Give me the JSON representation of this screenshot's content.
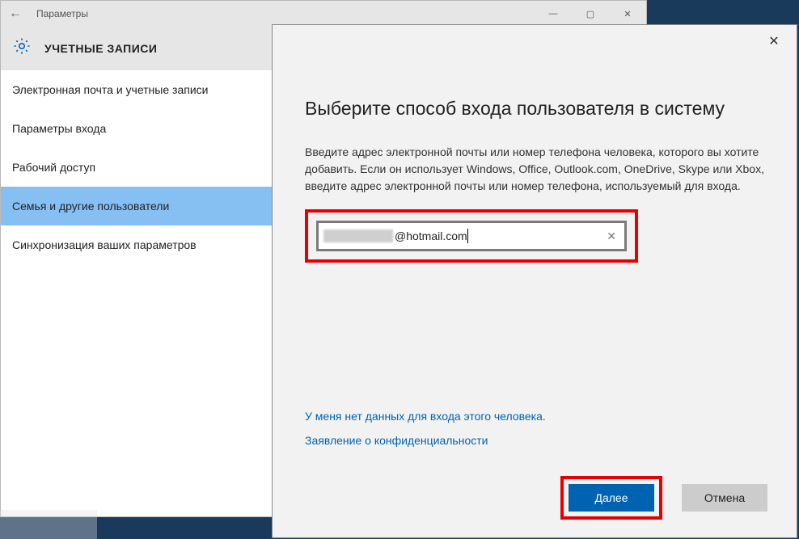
{
  "settings": {
    "titlebar_label": "Параметры",
    "heading": "УЧЕТНЫЕ ЗАПИСИ",
    "sidebar": [
      {
        "label": "Электронная почта и учетные записи",
        "selected": false
      },
      {
        "label": "Параметры входа",
        "selected": false
      },
      {
        "label": "Рабочий доступ",
        "selected": false
      },
      {
        "label": "Семья и другие пользователи",
        "selected": true
      },
      {
        "label": "Синхронизация ваших параметров",
        "selected": false
      }
    ]
  },
  "dialog": {
    "title": "Выберите способ входа пользователя в систему",
    "description": "Введите адрес электронной почты или номер телефона человека, которого вы хотите добавить. Если он использует Windows, Office, Outlook.com, OneDrive, Skype или Xbox, введите адрес электронной почты или номер телефона, используемый для входа.",
    "input_value_suffix": "@hotmail.com",
    "link_no_info": "У меня нет данных для входа этого человека.",
    "link_privacy": "Заявление о конфиденциальности",
    "btn_next": "Далее",
    "btn_cancel": "Отмена"
  }
}
